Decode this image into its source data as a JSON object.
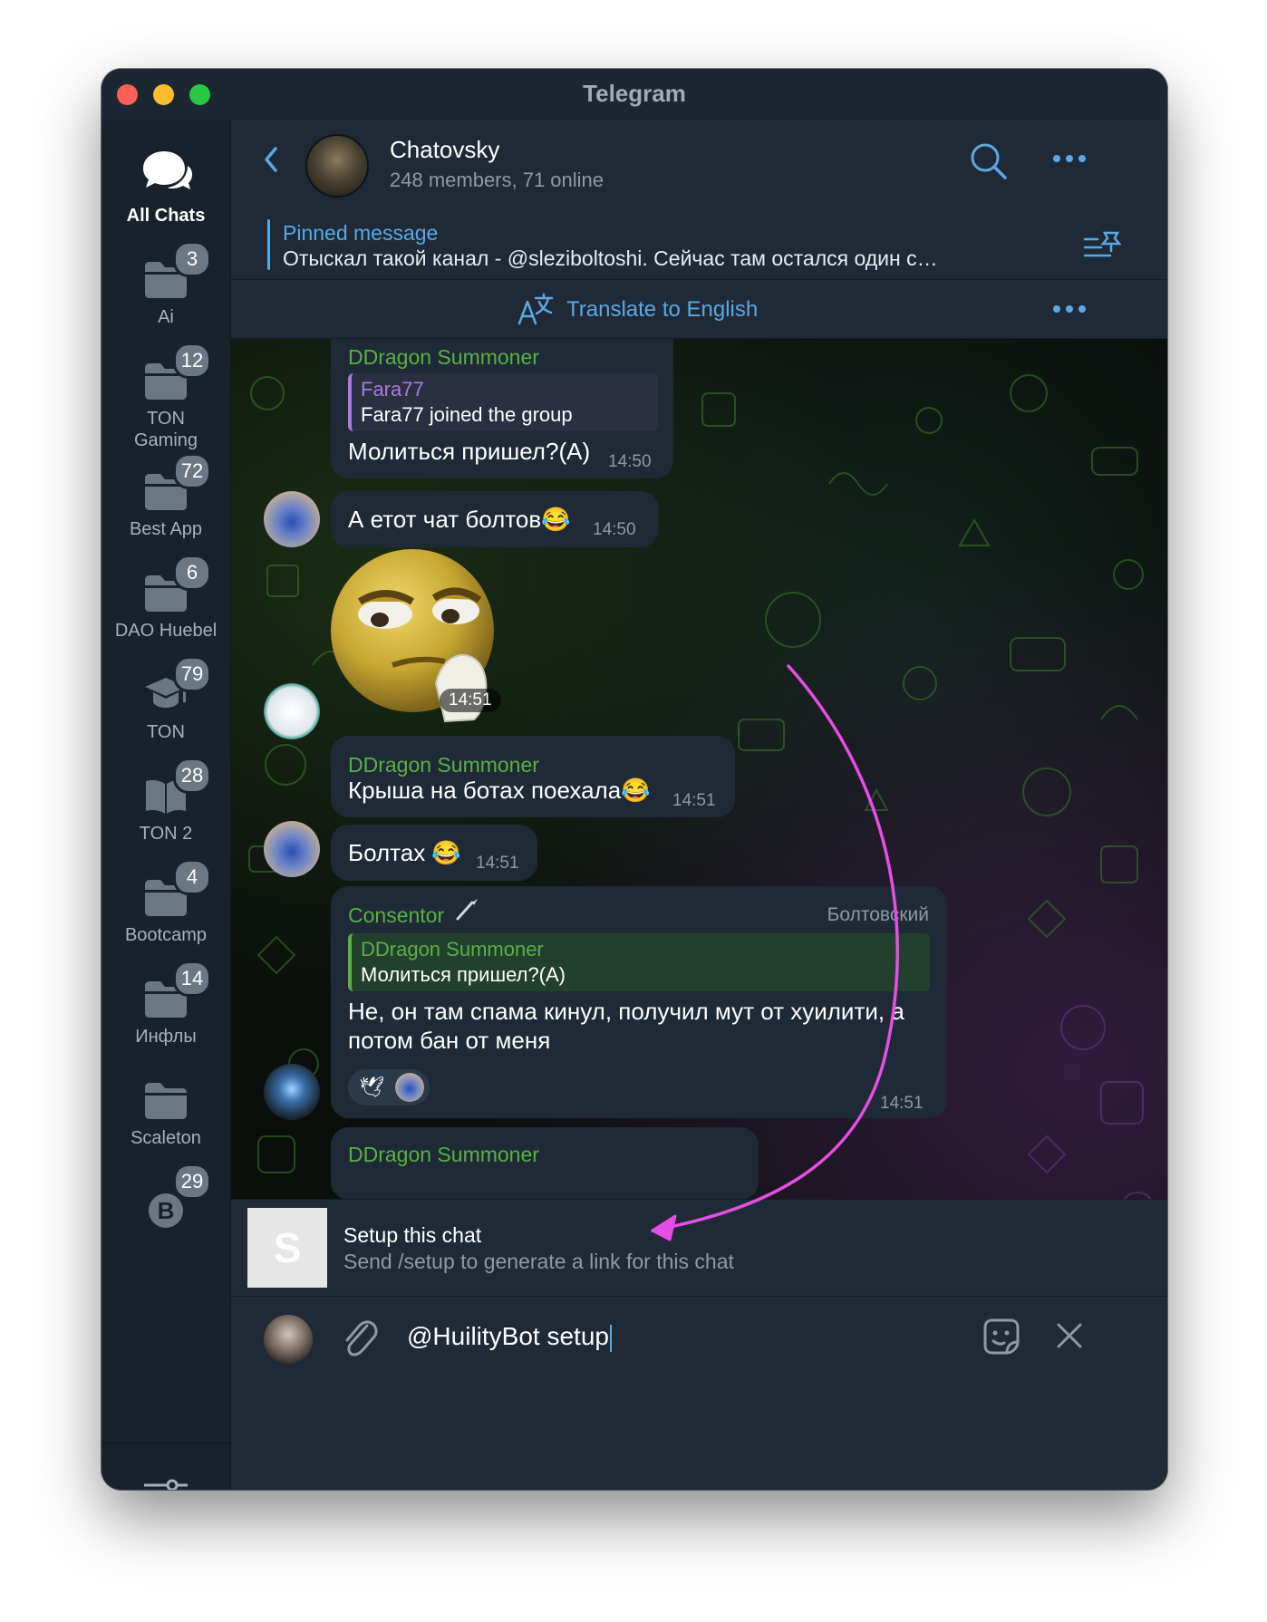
{
  "window": {
    "title": "Telegram"
  },
  "sidebar": {
    "folders": [
      {
        "label": "All Chats",
        "badge": ""
      },
      {
        "label": "Ai",
        "badge": "3"
      },
      {
        "label": "TON\nGaming",
        "badge": "12"
      },
      {
        "label": "Best App",
        "badge": "72"
      },
      {
        "label": "DAO Huebel",
        "badge": "6"
      },
      {
        "label": "TON",
        "badge": "79"
      },
      {
        "label": "TON 2",
        "badge": "28"
      },
      {
        "label": "Bootcamp",
        "badge": "4"
      },
      {
        "label": "Инфлы",
        "badge": "14"
      },
      {
        "label": "Scaleton",
        "badge": ""
      },
      {
        "label": "",
        "badge": "29"
      }
    ]
  },
  "header": {
    "chat_name": "Chatovsky",
    "chat_status": "248 members, 71 online"
  },
  "pinned": {
    "title": "Pinned message",
    "text": "Отыскал такой канал - @sleziboltoshi. Сейчас там остался один с…"
  },
  "translate": {
    "label": "Translate to English"
  },
  "messages": [
    {
      "sender": "DDragon Summoner",
      "quote_sender": "Fara77",
      "quote_text": "Fara77 joined the group",
      "text": "Молиться пришел?(A)",
      "time": "14:50"
    },
    {
      "text": "А етот чат болтов😂",
      "time": "14:50"
    },
    {
      "sticker": "thinking-emoji",
      "time": "14:51"
    },
    {
      "sender": "DDragon Summoner",
      "text": "Крыша на ботах поехала😂",
      "time": "14:51"
    },
    {
      "text": "Болтах 😂",
      "time": "14:51"
    },
    {
      "sender": "Consentor",
      "sender_tag": "Болтовский",
      "quote_sender": "DDragon Summoner",
      "quote_text": "Молиться пришел?(A)",
      "text": "Не, он там спама кинул, получил мут от хуилити, а потом бан от меня",
      "reaction": "🕊",
      "time": "14:51"
    },
    {
      "sender": "DDragon Summoner"
    }
  ],
  "bot_suggestion": {
    "avatar_letter": "S",
    "command": "Setup this chat",
    "description": "Send /setup to generate a link for this chat"
  },
  "composer": {
    "input_value": "@HuilityBot setup"
  },
  "colors": {
    "accent": "#5aa9e6",
    "sender_green": "#58b243",
    "quote_purple": "#a77be0",
    "arrow_magenta": "#e64ee6",
    "window_bg": "#1c2733"
  }
}
